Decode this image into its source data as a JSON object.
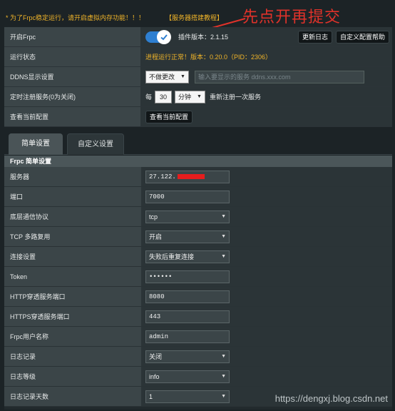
{
  "notice": {
    "warning_text": "* 为了Frpc稳定运行，请开启虚拟内存功能！！！",
    "tutorial_link": "【服务器搭建教程】"
  },
  "annotation_text": "先点开再提交",
  "config": {
    "enable_label": "开启Frpc",
    "enabled": true,
    "plugin_version": "插件版本：2.1.15",
    "changelog_button": "更新日志",
    "custom_help_button": "自定义配置帮助",
    "status_label": "运行状态",
    "status_value": "进程运行正常！版本：0.20.0（PID：2306）",
    "ddns_label": "DDNS显示设置",
    "ddns_select": "不做更改",
    "ddns_placeholder": "输入要显示的服务  ddns.xxx.com",
    "cron_label": "定时注册服务(0为关闭)",
    "cron_every": "每",
    "cron_value": "30",
    "cron_unit": "分钟",
    "cron_suffix": "重新注册一次服务",
    "view_label": "查看当前配置",
    "view_button": "查看当前配置"
  },
  "tabs": [
    {
      "label": "简单设置",
      "active": true
    },
    {
      "label": "自定义设置",
      "active": false
    }
  ],
  "form": {
    "header": "Frpc 简单设置",
    "rows": [
      {
        "label": "服务器",
        "value": "27.122.",
        "type": "input",
        "redacted": true
      },
      {
        "label": "端口",
        "value": "7000",
        "type": "input"
      },
      {
        "label": "底层通信协议",
        "value": "tcp",
        "type": "select"
      },
      {
        "label": "TCP 多路复用",
        "value": "开启",
        "type": "select"
      },
      {
        "label": "连接设置",
        "value": "失败后重复连接",
        "type": "select"
      },
      {
        "label": "Token",
        "value": "••••••",
        "type": "input"
      },
      {
        "label": "HTTP穿透服务端口",
        "value": "8080",
        "type": "input"
      },
      {
        "label": "HTTPS穿透服务端口",
        "value": "443",
        "type": "input"
      },
      {
        "label": "Frpc用户名称",
        "value": "admin",
        "type": "input"
      },
      {
        "label": "日志记录",
        "value": "关闭",
        "type": "select"
      },
      {
        "label": "日志等级",
        "value": "info",
        "type": "select"
      },
      {
        "label": "日志记录天数",
        "value": "1",
        "type": "select"
      }
    ]
  },
  "watermark": "https://dengxj.blog.csdn.net",
  "colors": {
    "accent": "#f0b429",
    "toggle": "#2e7fd1",
    "annotation": "#e0322a"
  }
}
